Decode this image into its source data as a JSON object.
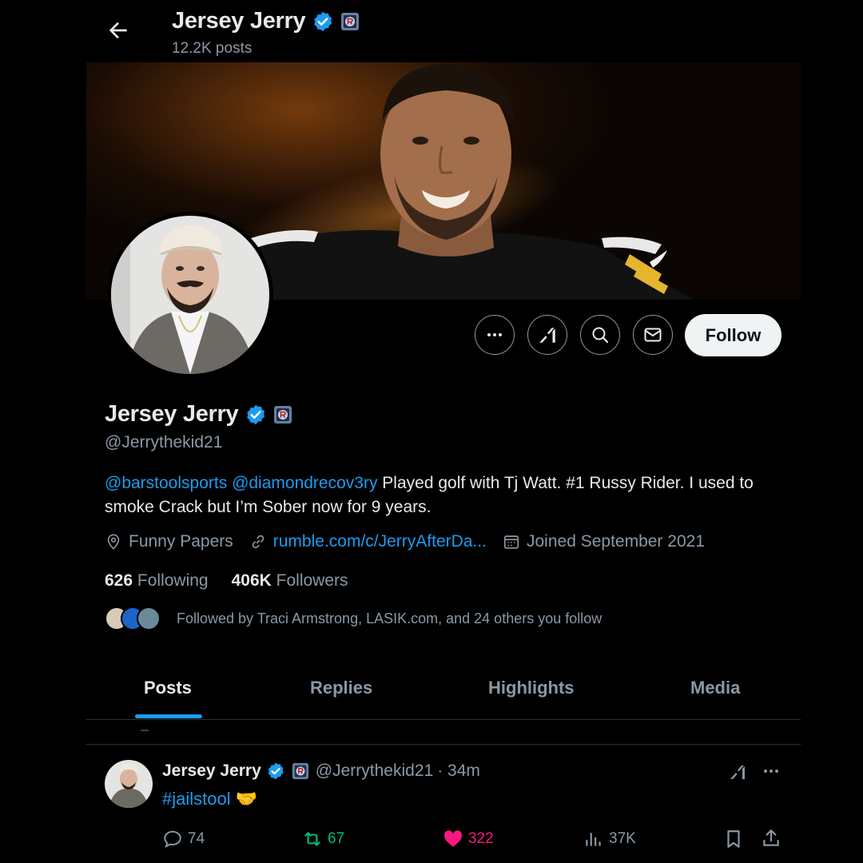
{
  "header": {
    "back_icon": "arrow-left-icon",
    "name": "Jersey Jerry",
    "posts_count": "12.2K posts"
  },
  "profile": {
    "name": "Jersey Jerry",
    "handle": "@Jerrythekid21",
    "bio_mention_1": "@barstoolsports",
    "bio_mention_2": "@diamondrecov3ry",
    "bio_text": " Played golf with Tj Watt. #1 Russy Rider. I used to smoke Crack but I’m Sober now for 9 years.",
    "location": "Funny Papers",
    "website": "rumble.com/c/JerryAfterDa...",
    "joined": "Joined September 2021",
    "following_count": "626",
    "following_label": "Following",
    "followers_count": "406K",
    "followers_label": "Followers",
    "followed_by": "Followed by Traci Armstrong, LASIK.com, and 24 others you follow"
  },
  "actions": {
    "follow_label": "Follow"
  },
  "tabs": [
    {
      "label": "Posts",
      "active": true
    },
    {
      "label": "Replies",
      "active": false
    },
    {
      "label": "Highlights",
      "active": false
    },
    {
      "label": "Media",
      "active": false
    }
  ],
  "post": {
    "author": "Jersey Jerry",
    "handle": "@Jerrythekid21",
    "time": "· 34m",
    "text": "#jailstool",
    "emoji": "🤝",
    "replies": "74",
    "reposts": "67",
    "likes": "322",
    "views": "37K"
  },
  "colors": {
    "accent": "#1d9bf0",
    "repost": "#00ba7c",
    "like": "#f91880",
    "muted": "#8b98a5",
    "background": "#000000"
  }
}
